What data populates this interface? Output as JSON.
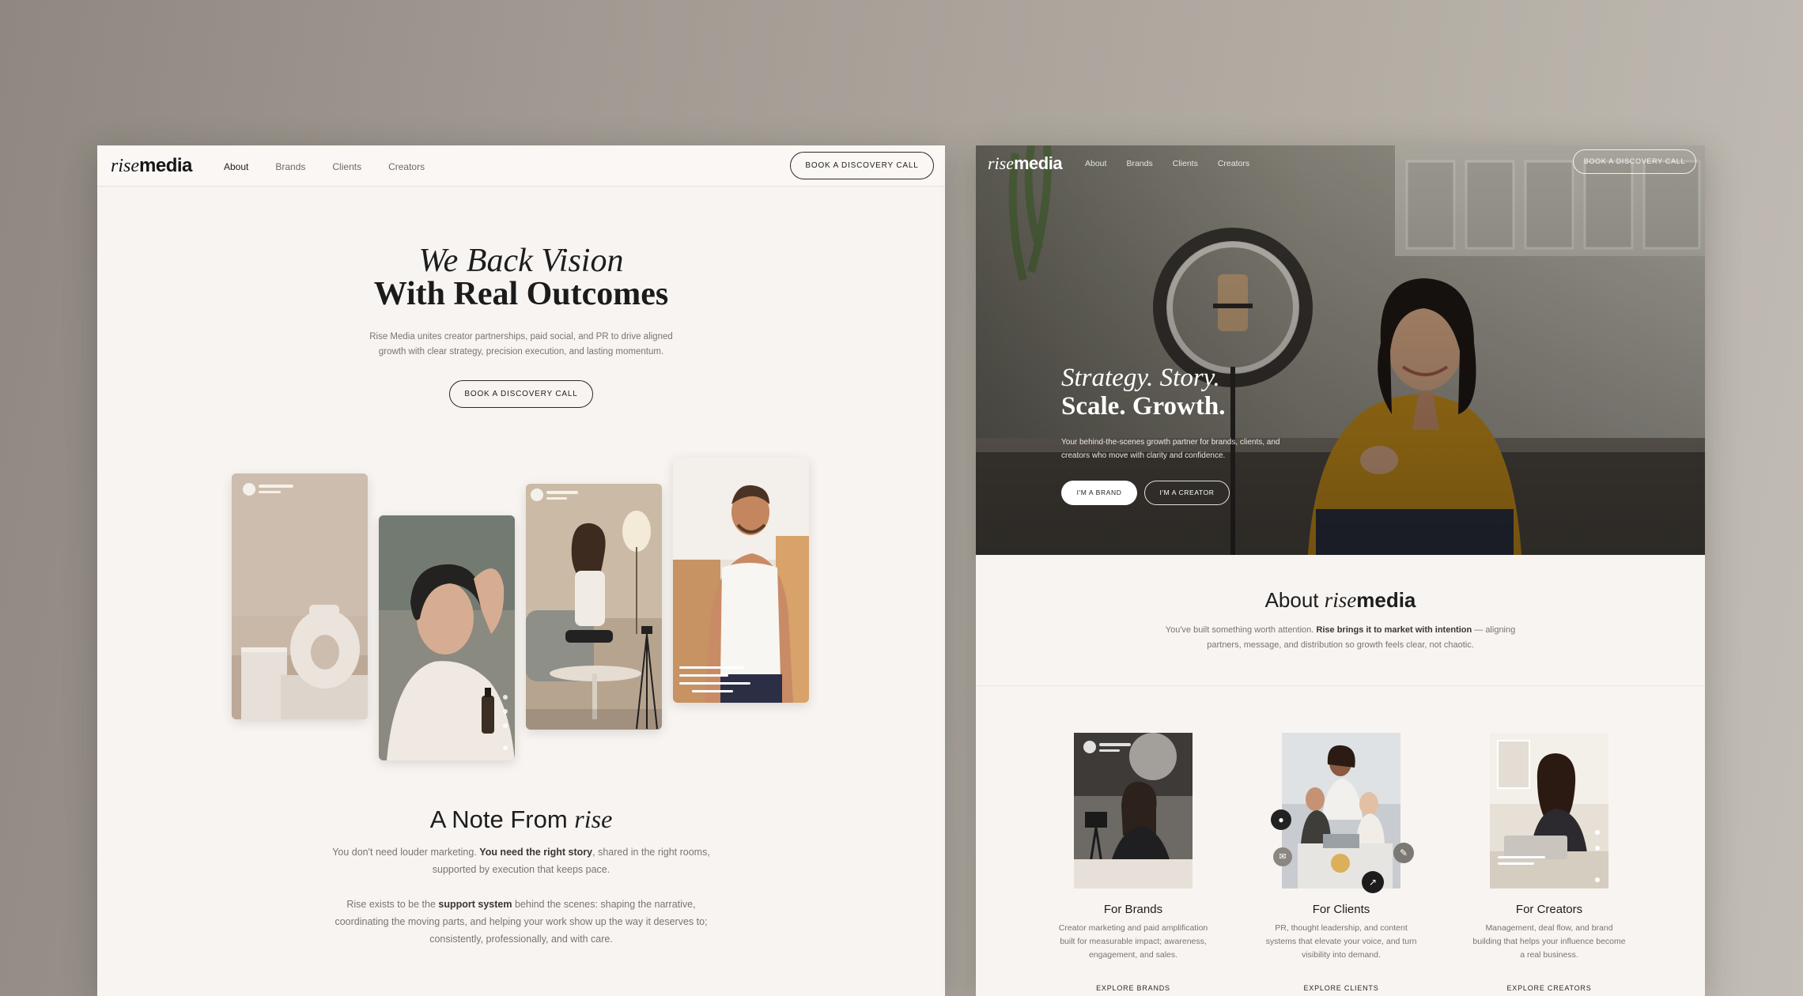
{
  "left": {
    "logo": {
      "rise": "rise",
      "media": "media"
    },
    "nav": [
      "About",
      "Brands",
      "Clients",
      "Creators"
    ],
    "cta": "BOOK A DISCOVERY CALL",
    "hero": {
      "line1": "We Back Vision",
      "line2": "With Real Outcomes",
      "subtitle": "Rise Media unites creator partnerships, paid social, and PR to drive aligned growth with clear strategy, precision execution, and lasting momentum.",
      "button": "BOOK A DISCOVERY CALL"
    },
    "note": {
      "title_prefix": "A Note From ",
      "title_italic": "rise",
      "p1_a": "You don't need louder marketing. ",
      "p1_b": "You need the right story",
      "p1_c": ", shared in the right rooms, supported by execution that keeps pace.",
      "p2_a": "Rise exists to be the ",
      "p2_b": "support system",
      "p2_c": " behind the scenes: shaping the narrative, coordinating the moving parts, and helping your work show up the way it deserves to; consistently, professionally, and with care."
    }
  },
  "right": {
    "logo": {
      "rise": "rise",
      "media": "media"
    },
    "nav": [
      "About",
      "Brands",
      "Clients",
      "Creators"
    ],
    "cta": "BOOK A DISCOVERY CALL",
    "hero": {
      "line1": "Strategy. Story.",
      "line2": "Scale. Growth.",
      "subtitle": "Your behind-the-scenes growth partner for brands, clients, and creators who move with clarity and confidence.",
      "btn_brand": "I'M A BRAND",
      "btn_creator": "I'M A CREATOR"
    },
    "about": {
      "title_prefix": "About ",
      "title_rise": "rise",
      "title_media": "media",
      "p_a": "You've built something worth attention. ",
      "p_b": "Rise brings it to market with intention",
      "p_c": " — aligning partners, message, and distribution so growth feels clear, not chaotic."
    },
    "features": [
      {
        "title": "For Brands",
        "desc": "Creator marketing and paid amplification built for measurable impact; awareness, engagement, and sales.",
        "link": "EXPLORE BRANDS"
      },
      {
        "title": "For Clients",
        "desc": "PR, thought leadership, and content systems that elevate your voice, and turn visibility into demand.",
        "link": "EXPLORE CLIENTS"
      },
      {
        "title": "For Creators",
        "desc": "Management, deal flow, and brand building that helps your influence become a real business.",
        "link": "EXPLORE CREATORS"
      }
    ]
  },
  "colors": {
    "page_bg": "#f8f4f1",
    "ink": "#1d1d1d",
    "muted": "#7a7470",
    "mustard": "#c8901c"
  },
  "icons": [
    "heart-icon",
    "comment-icon",
    "share-icon",
    "bookmark-icon",
    "music-icon",
    "mic-icon",
    "chart-icon",
    "pen-icon",
    "mail-icon"
  ]
}
